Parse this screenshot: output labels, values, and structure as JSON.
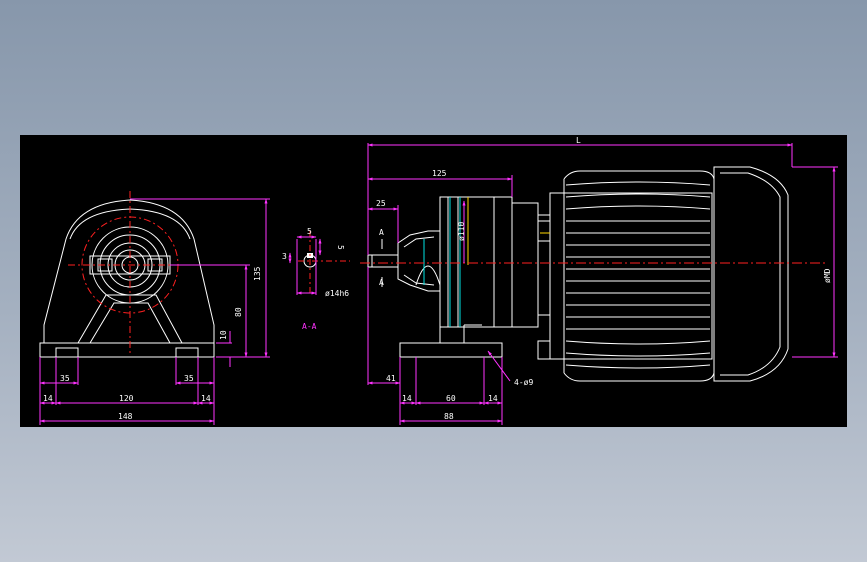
{
  "colors": {
    "background": "#000000",
    "outline": "#ffffff",
    "dimension": "#ff33ff",
    "centerline": "#ff2020",
    "hidden": "#00e5e5",
    "construction": "#ffd800"
  },
  "front_view": {
    "dim_135": "135",
    "dim_80": "80",
    "dim_10": "10",
    "dim_35_left": "35",
    "dim_35_right": "35",
    "dim_14_left": "14",
    "dim_120": "120",
    "dim_14_right": "14",
    "dim_148": "148"
  },
  "section_view": {
    "dim_5_top": "5",
    "dim_5_side": "5",
    "dim_3": "3",
    "dim_shaft": "ø14h6",
    "label": "A-A"
  },
  "side_view": {
    "dim_L": "L",
    "dim_125": "125",
    "dim_25": "25",
    "dim_110": "ø110",
    "section_mark_top": "A",
    "section_mark_bottom": "A",
    "dim_41": "41",
    "dim_14_left": "14",
    "dim_60": "60",
    "dim_14_right": "14",
    "dim_88": "88",
    "dim_holes": "4-ø9",
    "dim_motor_dia": "øMD"
  }
}
